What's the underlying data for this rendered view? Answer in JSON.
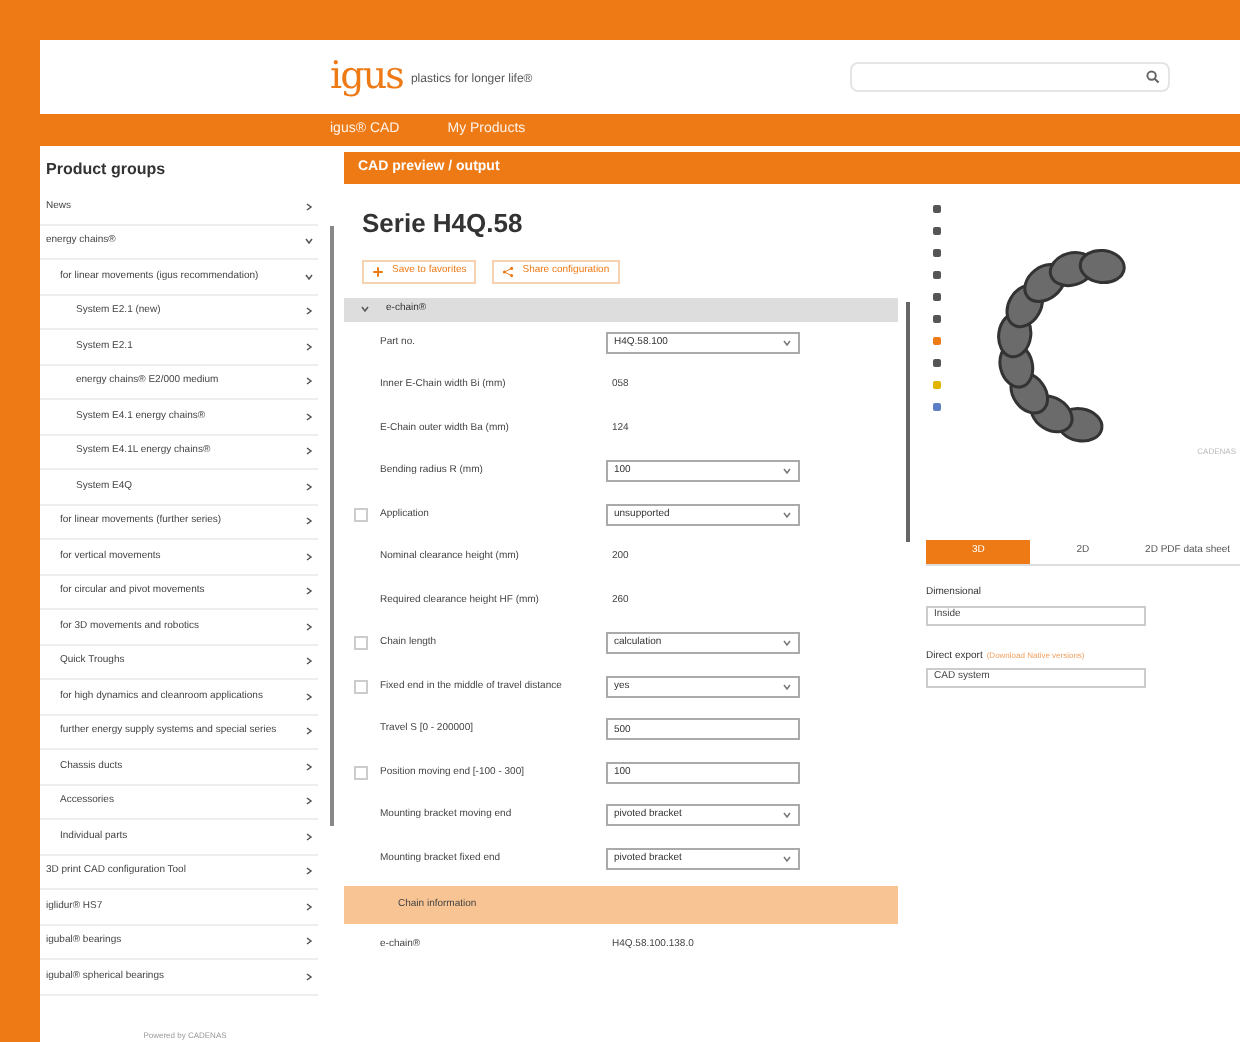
{
  "header": {
    "logo": "igus",
    "tagline": "plastics for longer life®"
  },
  "nav": [
    {
      "label": "igus® CAD",
      "selected": false
    },
    {
      "label": "My Products",
      "selected": false
    }
  ],
  "sidebar": {
    "title": "Product groups",
    "items": [
      {
        "label": "News",
        "expanded": false
      },
      {
        "label": "energy chains®",
        "expanded": true,
        "children": [
          {
            "label": "for linear movements (igus recommendation)",
            "expanded": true,
            "children": [
              {
                "label": "System E2.1 (new)",
                "expanded": false
              },
              {
                "label": "System E2.1",
                "expanded": false
              },
              {
                "label": "energy chains® E2/000 medium",
                "expanded": false
              },
              {
                "label": "System E4.1 energy chains®",
                "expanded": false
              },
              {
                "label": "System E4.1L energy chains®",
                "expanded": false
              },
              {
                "label": "System E4Q",
                "expanded": false
              }
            ]
          },
          {
            "label": "for linear movements (further series)",
            "expanded": false
          },
          {
            "label": "for vertical movements",
            "expanded": false
          },
          {
            "label": "for circular and pivot movements",
            "expanded": false
          },
          {
            "label": "for 3D movements and robotics",
            "expanded": false
          },
          {
            "label": "Quick Troughs",
            "expanded": false
          },
          {
            "label": "for high dynamics and cleanroom applications",
            "expanded": false
          },
          {
            "label": "further energy supply systems and special series",
            "expanded": false
          },
          {
            "label": "Chassis ducts",
            "expanded": false
          },
          {
            "label": "Accessories",
            "expanded": false
          },
          {
            "label": "Individual parts",
            "expanded": false
          }
        ]
      },
      {
        "label": "3D print CAD configuration Tool",
        "expanded": false
      },
      {
        "label": "iglidur® HS7",
        "expanded": false
      },
      {
        "label": "igubal® bearings",
        "expanded": false
      },
      {
        "label": "igubal® spherical bearings",
        "expanded": false
      }
    ],
    "footer": "Powered by CADENAS"
  },
  "panel_title": "CAD preview / output",
  "product": {
    "title": "Serie H4Q.58",
    "actions": [
      {
        "label": "Save to favorites"
      },
      {
        "label": "Share configuration"
      }
    ]
  },
  "form": {
    "section": "e-chain®",
    "rows": [
      {
        "kind": "select",
        "label": "Part no.",
        "value": "H4Q.58.100",
        "info": false
      },
      {
        "kind": "value",
        "label": "Inner E-Chain width Bi (mm)",
        "value": "058",
        "info": false
      },
      {
        "kind": "value",
        "label": "E-Chain outer width Ba (mm)",
        "value": "124",
        "info": false
      },
      {
        "kind": "select",
        "label": "Bending radius R (mm)",
        "value": "100",
        "info": false
      },
      {
        "kind": "select",
        "label": "Application",
        "value": "unsupported",
        "info": true
      },
      {
        "kind": "value",
        "label": "Nominal clearance height (mm)",
        "value": "200",
        "info": false
      },
      {
        "kind": "value",
        "label": "Required clearance height HF (mm)",
        "value": "260",
        "info": false
      },
      {
        "kind": "select",
        "label": "Chain length",
        "value": "calculation",
        "info": true
      },
      {
        "kind": "select",
        "label": "Fixed end in the middle of travel distance",
        "value": "yes",
        "info": true
      },
      {
        "kind": "input",
        "label": "Travel S [0 - 200000]",
        "value": "500",
        "info": false
      },
      {
        "kind": "input",
        "label": "Position moving end [-100 - 300]",
        "value": "100",
        "info": true
      },
      {
        "kind": "select",
        "label": "Mounting bracket moving end",
        "value": "pivoted bracket",
        "info": false
      },
      {
        "kind": "select",
        "label": "Mounting bracket fixed end",
        "value": "pivoted bracket",
        "info": false
      },
      {
        "kind": "banner",
        "label": "Chain information"
      },
      {
        "kind": "value",
        "label": "e-chain®",
        "value": "H4Q.58.100.138.0",
        "info": false
      }
    ]
  },
  "viewer": {
    "caption": "CADENAS",
    "modes": [
      {
        "label": "3D",
        "selected": true
      },
      {
        "label": "2D",
        "selected": false
      },
      {
        "label": "2D PDF data sheet",
        "selected": false
      }
    ],
    "dimensional": {
      "label": "Dimensional",
      "value": "Inside"
    },
    "export": {
      "label": "Direct export",
      "link": "(Download Native versions)",
      "value": "CAD system"
    }
  }
}
